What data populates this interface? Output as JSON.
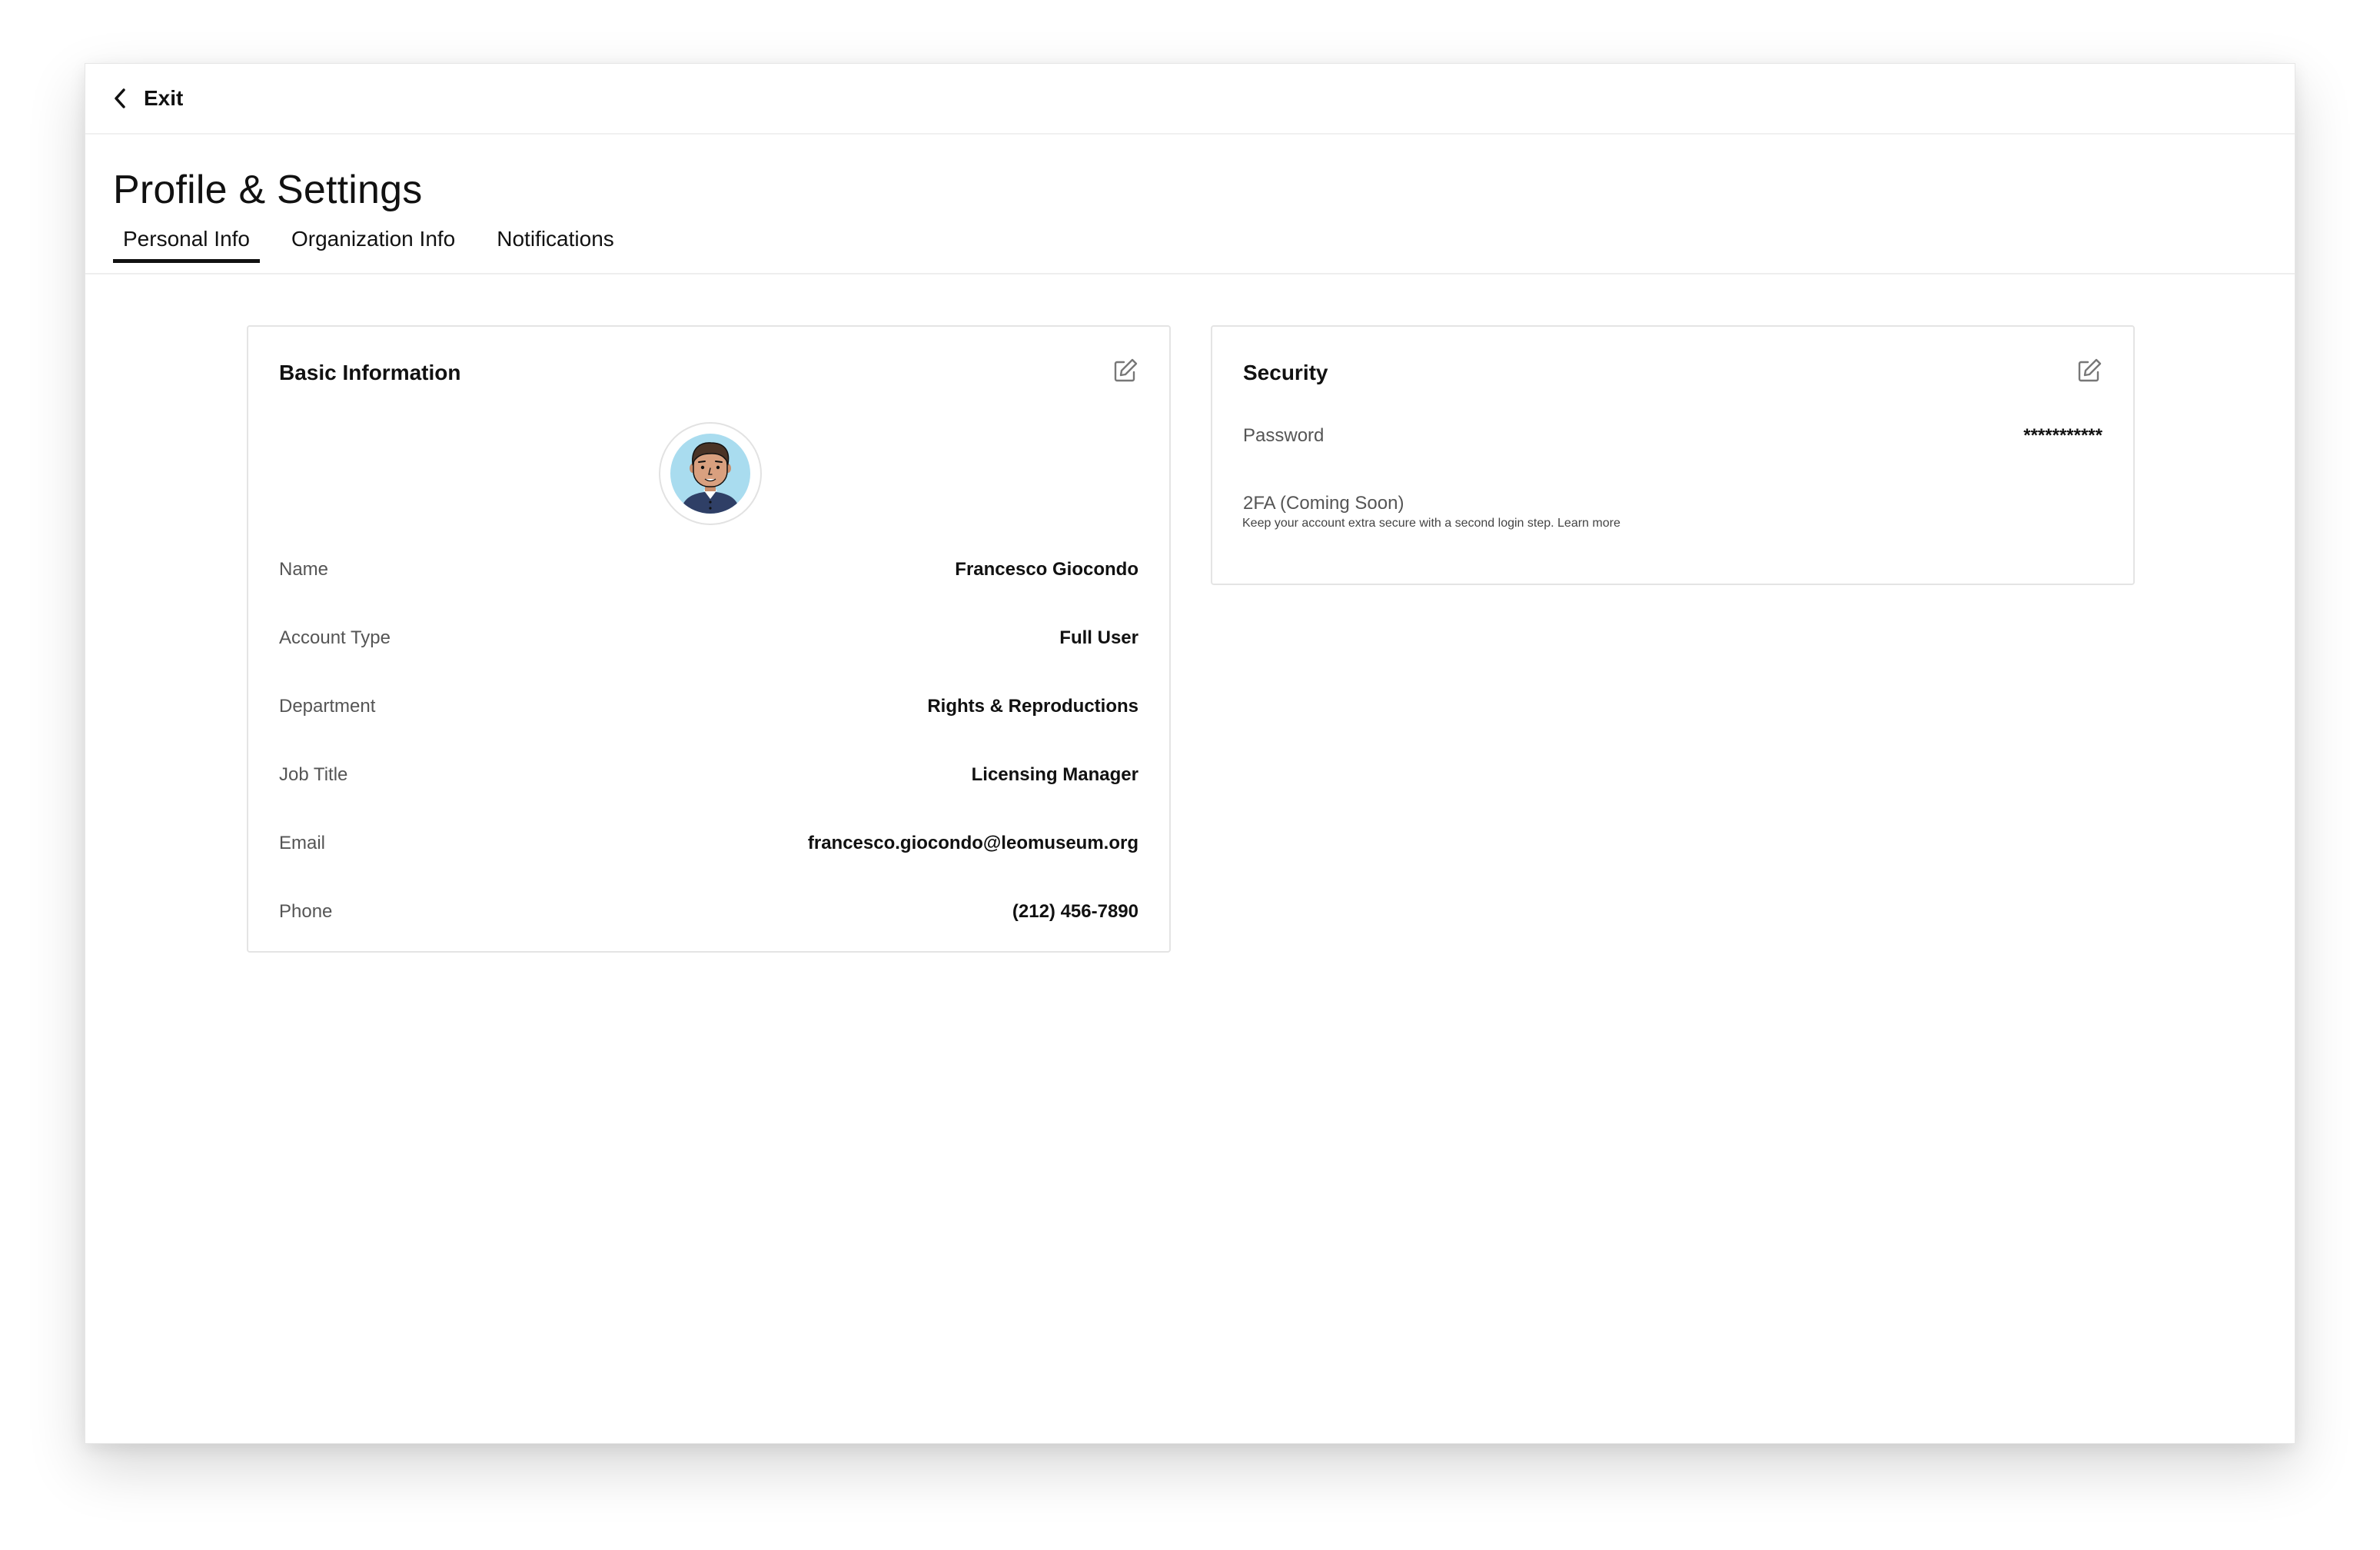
{
  "header": {
    "exit_label": "Exit"
  },
  "page": {
    "title": "Profile & Settings"
  },
  "tabs": [
    {
      "label": "Personal Info",
      "active": true
    },
    {
      "label": "Organization Info",
      "active": false
    },
    {
      "label": "Notifications",
      "active": false
    }
  ],
  "basic_info": {
    "title": "Basic Information",
    "rows": [
      {
        "label": "Name",
        "value": "Francesco Giocondo"
      },
      {
        "label": "Account Type",
        "value": "Full User"
      },
      {
        "label": "Department",
        "value": "Rights & Reproductions"
      },
      {
        "label": "Job Title",
        "value": "Licensing Manager"
      },
      {
        "label": "Email",
        "value": "francesco.giocondo@leomuseum.org"
      },
      {
        "label": "Phone",
        "value": "(212) 456-7890"
      }
    ]
  },
  "security": {
    "title": "Security",
    "password_label": "Password",
    "password_value": "***********",
    "twofa_label": "2FA (Coming Soon)",
    "twofa_description": "Keep your account extra secure with a second login step. Learn more"
  },
  "colors": {
    "text": "#111111",
    "muted": "#555555",
    "border": "#e4e4e4",
    "avatar_bg": "#a9dcef",
    "shirt": "#2f3f66"
  },
  "icons": {
    "back": "chevron-left-icon",
    "edit": "edit-icon"
  }
}
